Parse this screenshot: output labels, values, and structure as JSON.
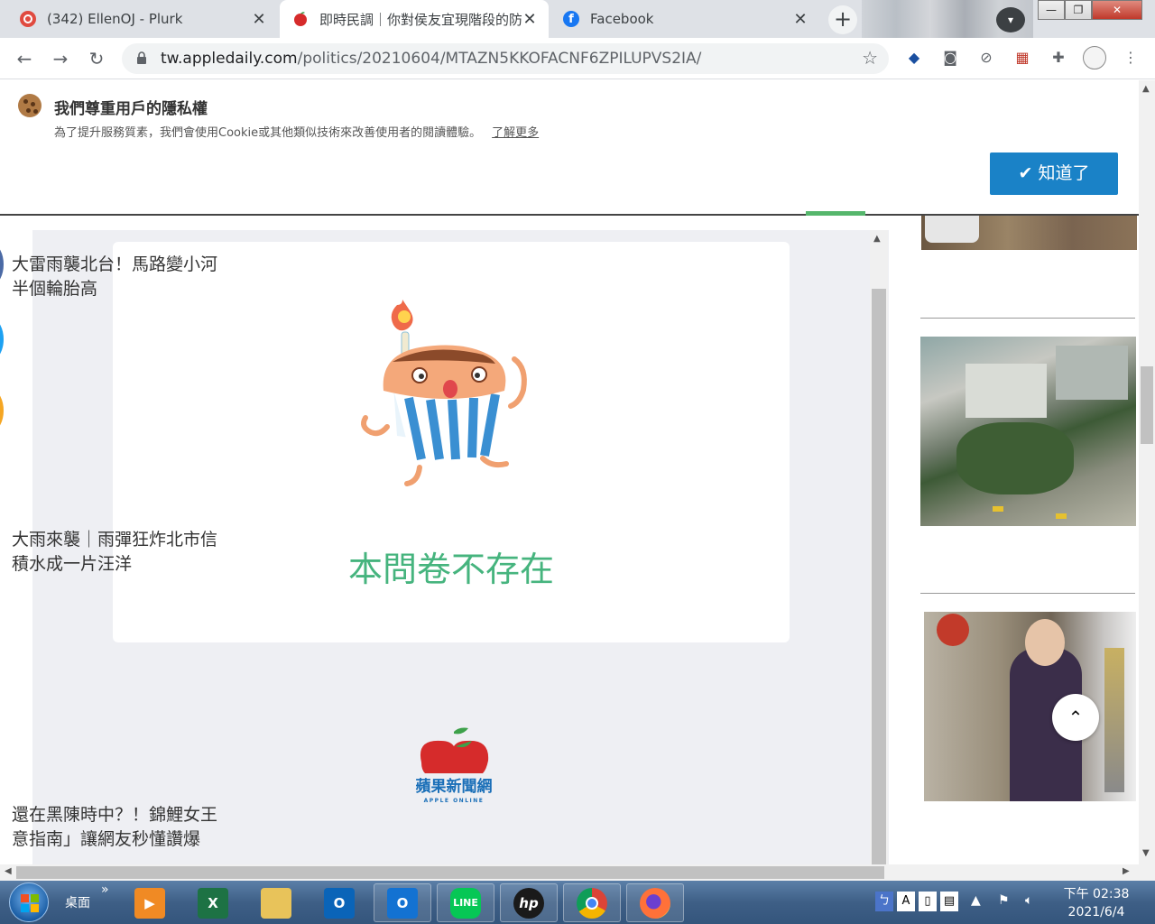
{
  "browser": {
    "tabs": [
      {
        "title": "(342) EllenOJ - Plurk",
        "active": false
      },
      {
        "title": "即時民調｜你對侯友宜現階段的防",
        "active": true
      },
      {
        "title": "Facebook",
        "active": false
      }
    ],
    "tab_close": "✕",
    "new_tab": "+",
    "window_buttons": {
      "minimize": "—",
      "maximize": "❐",
      "close": "✕"
    },
    "url_host": "tw.appledaily.com",
    "url_path": "/politics/20210604/MTAZN5KKOFACNF6ZPILUPVS2IA/",
    "nav": {
      "back": "←",
      "forward": "→",
      "reload": "↻"
    },
    "bookmark_star": "☆",
    "menu": "⋮"
  },
  "consent": {
    "title": "我們尊重用戶的隱私權",
    "text": "為了提升服務質素，我們會使用Cookie或其他類似技術來改善使用者的閱讀體驗。",
    "link": "了解更多",
    "button_check": "✔",
    "button": "知道了"
  },
  "survey": {
    "message": "本問卷不存在",
    "logo_text": "蘋果新聞網",
    "logo_sub": "APPLE ONLINE"
  },
  "sidebar_news": [
    {
      "caption_line1": "大雷雨襲北台！馬路變小河",
      "caption_line2": "半個輪胎高"
    },
    {
      "caption_line1": "大雨來襲｜雨彈狂炸北市信",
      "caption_line2": "積水成一片汪洋"
    },
    {
      "caption_line1": "還在黑陳時中？！錦鯉女王",
      "caption_line2": "意指南」讓網友秒懂讚爆"
    }
  ],
  "back_to_top": "⌃",
  "taskbar": {
    "desktop_label": "桌面",
    "chevron": "»",
    "apps": [
      {
        "name": "media-player",
        "label": "▶",
        "color": "#f08a24"
      },
      {
        "name": "excel",
        "label": "X",
        "color": "#1d7244"
      },
      {
        "name": "file-explorer",
        "label": "",
        "color": "#e8c35a"
      },
      {
        "name": "outlook",
        "label": "O",
        "color": "#0a64b8"
      },
      {
        "name": "outlook-mail",
        "label": "O",
        "color": "#1372d2"
      },
      {
        "name": "line",
        "label": "LINE",
        "color": "#06c755"
      },
      {
        "name": "hp",
        "label": "hp",
        "color": "#1a1a1a"
      },
      {
        "name": "chrome",
        "label": "",
        "color": "#db4437"
      },
      {
        "name": "firefox",
        "label": "",
        "color": "#e66000"
      }
    ],
    "clock_time": "下午 02:38",
    "clock_date": "2021/6/4"
  }
}
